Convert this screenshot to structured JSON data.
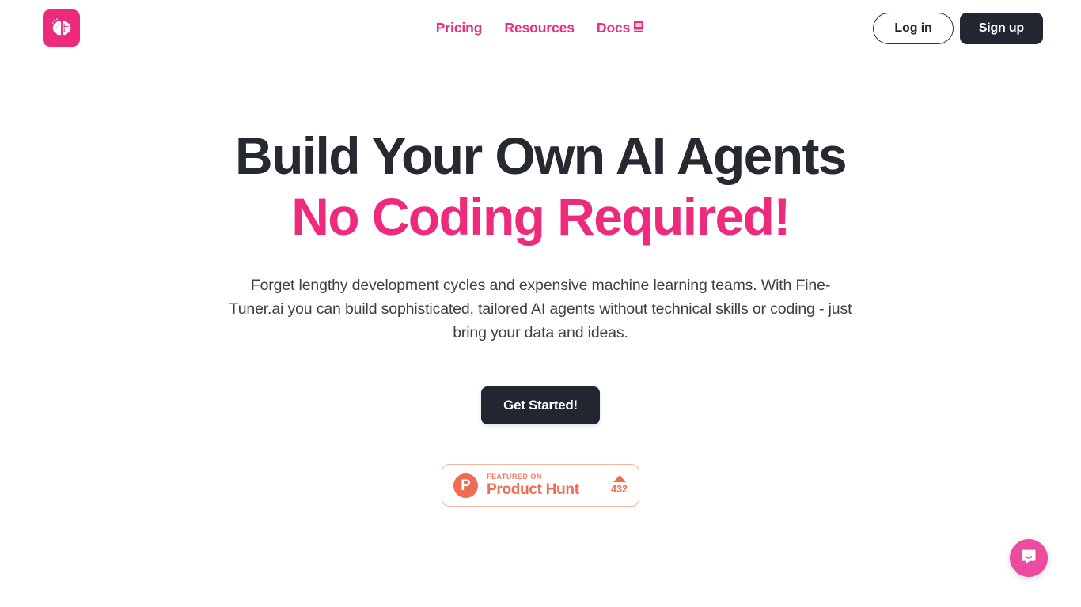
{
  "brand": {
    "logo_icon": "brain-logo-icon",
    "pink": "#ED2A7B",
    "dark": "#222630",
    "coral": "#EF6B52"
  },
  "nav": {
    "items": [
      {
        "label": "Pricing",
        "icon": ""
      },
      {
        "label": "Resources",
        "icon": ""
      },
      {
        "label": "Docs",
        "icon": "book-icon"
      }
    ]
  },
  "auth": {
    "login_label": "Log in",
    "signup_label": "Sign up"
  },
  "hero": {
    "headline_line1": "Build Your Own AI Agents",
    "headline_line2": "No Coding Required!",
    "subtitle": "Forget lengthy development cycles and expensive machine learning teams. With Fine-Tuner.ai you can build sophisticated, tailored AI agents without technical skills or coding - just bring your data and ideas.",
    "cta_label": "Get Started!"
  },
  "product_hunt": {
    "featured_label": "FEATURED ON",
    "name": "Product Hunt",
    "logo_letter": "P",
    "upvote_count": "432",
    "upvote_icon": "triangle-up-icon"
  },
  "chat": {
    "icon": "chat-bubble-icon"
  }
}
